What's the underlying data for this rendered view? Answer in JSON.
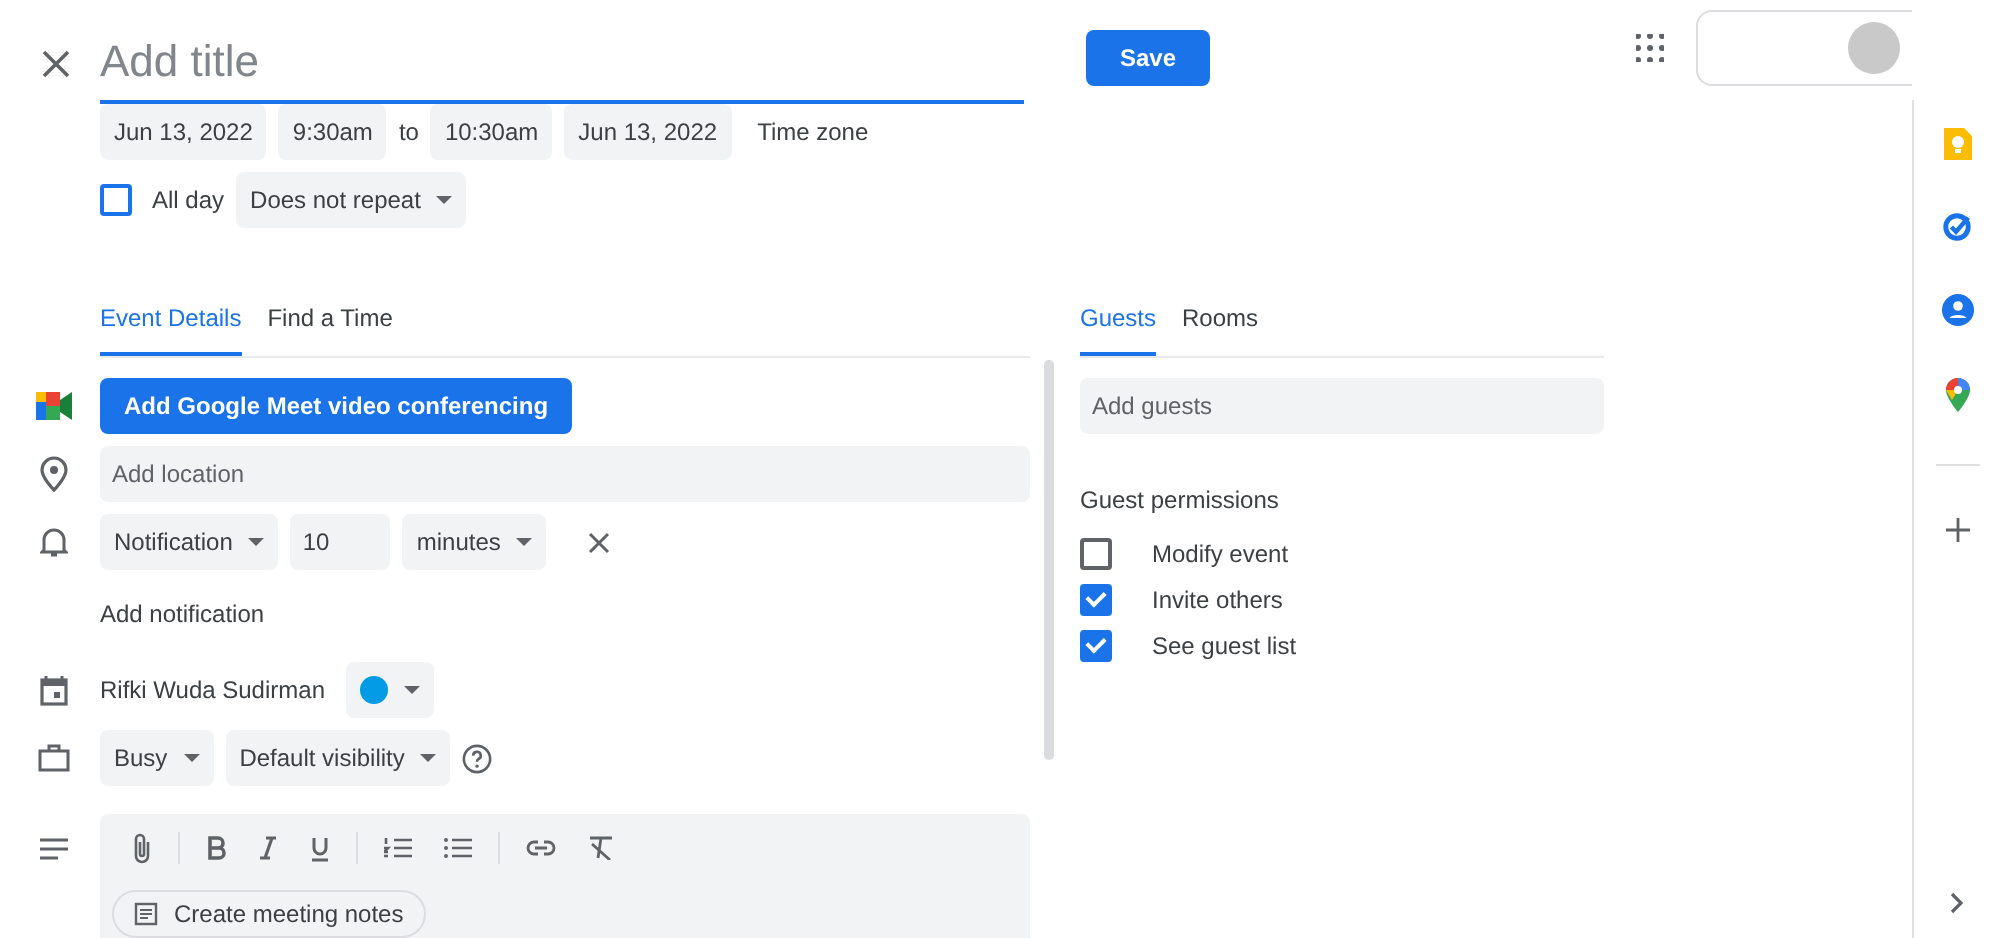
{
  "header": {
    "title_placeholder": "Add title",
    "save": "Save"
  },
  "date_row": {
    "start_date": "Jun 13, 2022",
    "start_time": "9:30am",
    "separator": "to",
    "end_time": "10:30am",
    "end_date": "Jun 13, 2022",
    "time_zone": "Time zone"
  },
  "all_day": {
    "label": "All day",
    "checked": false
  },
  "repeat": "Does not repeat",
  "tabs": [
    {
      "label": "Event Details",
      "selected": true
    },
    {
      "label": "Find a Time",
      "selected": false
    }
  ],
  "meet_button": "Add Google Meet video conferencing",
  "location": {
    "placeholder": "Add location"
  },
  "notification": {
    "type": "Notification",
    "value": "10",
    "unit": "minutes"
  },
  "add_notification": "Add notification",
  "calendar": {
    "owner": "Rifki Wuda Sudirman",
    "color": "#039be5"
  },
  "availability": "Busy",
  "visibility": "Default visibility",
  "create_notes": "Create meeting notes",
  "guest_tabs": [
    {
      "label": "Guests",
      "selected": true
    },
    {
      "label": "Rooms",
      "selected": false
    }
  ],
  "guests": {
    "placeholder": "Add guests"
  },
  "permissions": {
    "heading": "Guest permissions",
    "items": [
      {
        "label": "Modify event",
        "checked": false
      },
      {
        "label": "Invite others",
        "checked": true
      },
      {
        "label": "See guest list",
        "checked": true
      }
    ]
  }
}
